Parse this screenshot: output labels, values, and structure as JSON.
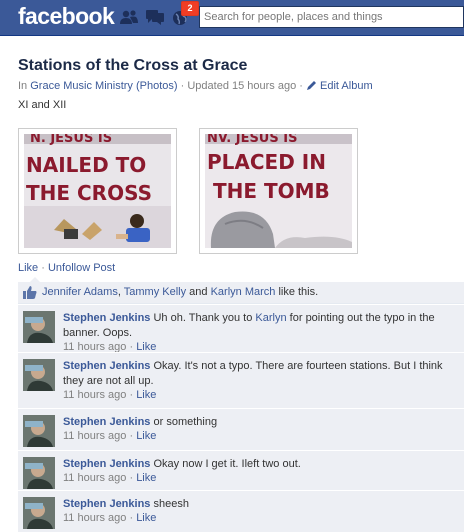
{
  "topbar": {
    "logo": "facebook",
    "notifications_count": "2",
    "search_placeholder": "Search for people, places and things"
  },
  "album": {
    "title": "Stations of the Cross at Grace",
    "meta_prefix": "In",
    "owner": "Grace Music Ministry (Photos)",
    "updated": "Updated 15 hours ago",
    "edit_label": "Edit Album",
    "caption": "XI and XII",
    "photos": [
      {
        "banner_line1": "N. JESUS IS",
        "banner_line2": "NAILED TO",
        "banner_line3": "THE CROSS"
      },
      {
        "banner_line1": "NV. JESUS IS",
        "banner_line2": "PLACED IN",
        "banner_line3": "THE TOMB"
      }
    ]
  },
  "actions": {
    "like": "Like",
    "sep": "·",
    "unfollow": "Unfollow Post"
  },
  "likes": {
    "person1": "Jennifer Adams",
    "comma": ",",
    "person2": "Tammy Kelly",
    "and": "and",
    "person3": "Karlyn March",
    "suffix": "like this."
  },
  "comments": [
    {
      "author": "Stephen Jenkins",
      "text_before": "Uh oh. Thank you to",
      "mention": "Karlyn",
      "text_after": "for pointing out the typo in the banner. Oops.",
      "time": "11 hours ago",
      "like": "Like"
    },
    {
      "author": "Stephen Jenkins",
      "text": "Okay. It's not a typo. There are fourteen stations. But I think they are not all up.",
      "time": "11 hours ago",
      "like": "Like"
    },
    {
      "author": "Stephen Jenkins",
      "text": "or something",
      "time": "11 hours ago",
      "like": "Like"
    },
    {
      "author": "Stephen Jenkins",
      "text": "Okay now I get it. Ileft two out.",
      "time": "11 hours ago",
      "like": "Like"
    },
    {
      "author": "Stephen Jenkins",
      "text": "sheesh",
      "time": "11 hours ago",
      "like": "Like"
    }
  ],
  "colors": {
    "brand": "#3b5998",
    "ufi_bg": "#edeff4",
    "banner_text": "#8b1a2e"
  }
}
